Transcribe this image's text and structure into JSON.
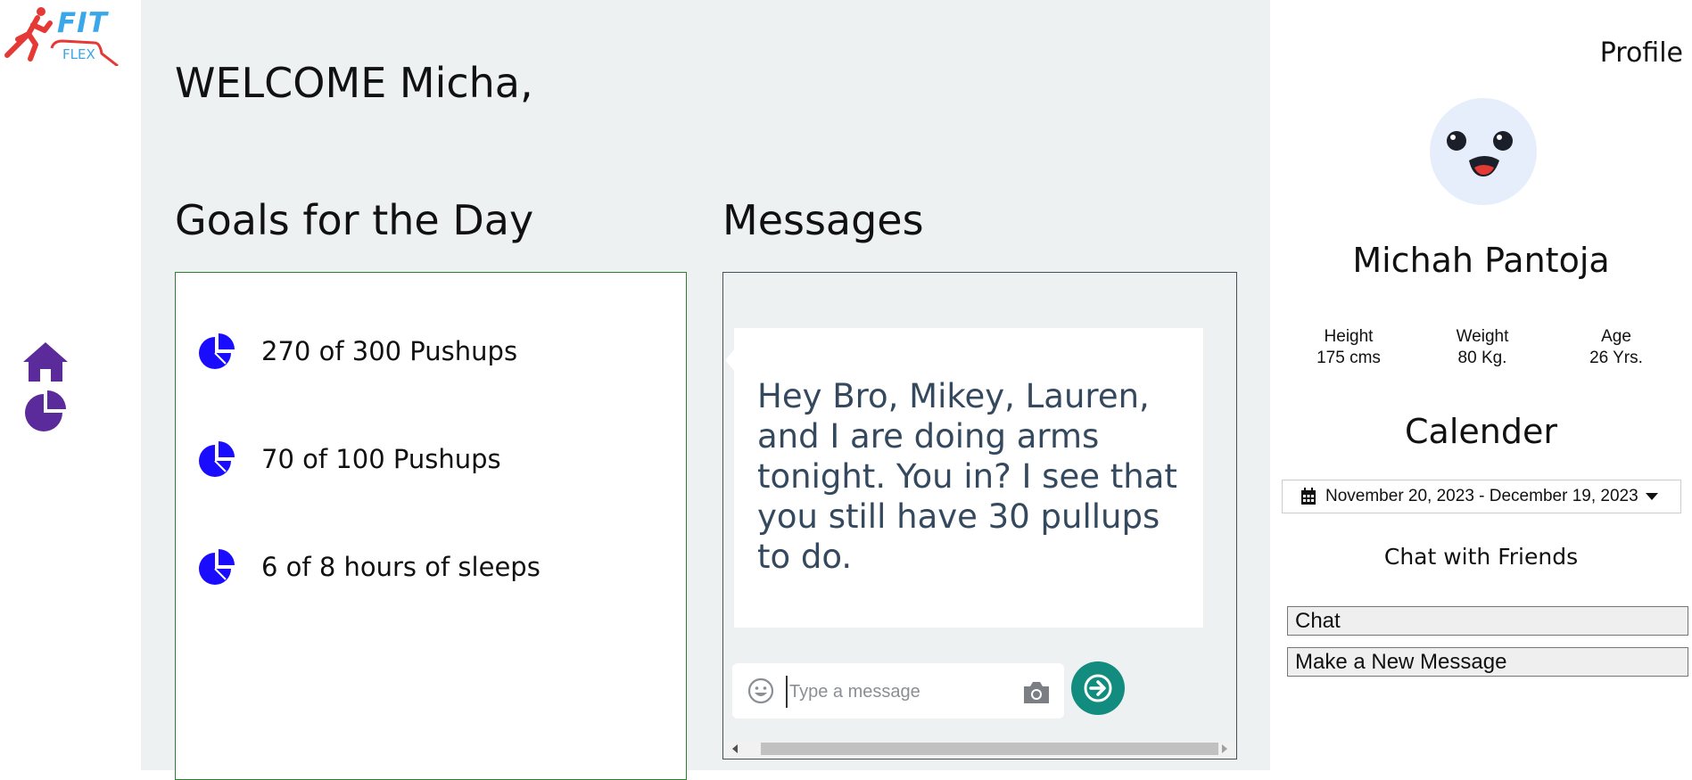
{
  "app": {
    "logo_text_main": "FIT",
    "logo_text_sub": "FLEX",
    "brand_color": "#3aa8e8",
    "logo_runner_color": "#e53935"
  },
  "nav": {
    "items": [
      {
        "icon": "home-icon",
        "color": "#5b2a9b"
      },
      {
        "icon": "pie-chart-icon",
        "color": "#5b2a9b"
      }
    ]
  },
  "main": {
    "welcome": "WELCOME Micha,",
    "goals_title": "Goals for the Day",
    "goals": [
      {
        "icon": "pie-chart-icon",
        "label": "270 of 300 Pushups"
      },
      {
        "icon": "pie-chart-icon",
        "label": "70 of 100 Pushups"
      },
      {
        "icon": "pie-chart-icon",
        "label": "6 of 8 hours of sleeps"
      }
    ],
    "goal_icon_color": "#1a0dff",
    "messages_title": "Messages",
    "message_text": "Hey Bro, Mikey, Lauren, and I are doing arms tonight. You in? I see that you still have 30 pullups to do.",
    "input": {
      "placeholder": "Type a message",
      "value": ""
    },
    "send_color": "#128c7e"
  },
  "profile": {
    "title": "Profile",
    "name": "Michah Pantoja",
    "stats": [
      {
        "label": "Height",
        "value": "175 cms"
      },
      {
        "label": "Weight",
        "value": "80 Kg."
      },
      {
        "label": "Age",
        "value": "26 Yrs."
      }
    ],
    "calendar_title": "Calender",
    "date_range": "November 20, 2023 - December 19, 2023",
    "chat_title": "Chat with Friends",
    "chat_button": "Chat",
    "new_message_button": "Make a New Message"
  }
}
